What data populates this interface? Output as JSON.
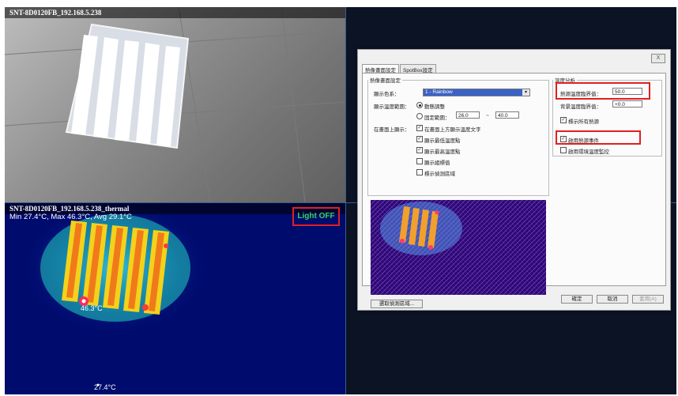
{
  "cameras": {
    "cam": {
      "title": "SNT-8D0120FB_192.168.5.238"
    },
    "thermal": {
      "title": "SNT-8D0120FB_192.168.5.238_thermal",
      "stats": "Min 27.4°C, Max 46.3°C, Avg 29.1°C",
      "status": "Light OFF",
      "max_marker": "46.3°C",
      "min_marker": "27.4°C"
    }
  },
  "dialog": {
    "close": "X",
    "tabs": [
      "熱像畫面設定",
      "SpotBox設定"
    ],
    "left_group": {
      "legend": "熱像畫面設定",
      "palette_label": "顯示色系：",
      "palette_value": "1 - Rainbow",
      "range_label": "顯示溫度範圍：",
      "auto_label": "動態調整",
      "fixed_label": "固定範圍：",
      "fixed_min": "26.0",
      "fixed_sep": "~",
      "fixed_max": "40.0",
      "overlay_label": "在畫面上顯示：",
      "overlay_options": [
        "在畫面上方顯示溫度文字",
        "顯示最低溫度點",
        "顯示最高溫度點",
        "顯示組標值",
        "標示偵測區域"
      ]
    },
    "right_group": {
      "legend": "溫度分析",
      "heat_label": "熱源溫度臨界值：",
      "heat_value": "50.0",
      "bg_label": "背景溫度臨界值：",
      "bg_value": "+0.0",
      "mark_all": "標示所有熱源",
      "enable_heat_event": "啟用熱源事件",
      "enable_env_monitor": "啟用環境溫度監控"
    },
    "select_area_button": "選取偵測區域...",
    "ok": "確定",
    "cancel": "取消",
    "apply": "套用(A)"
  }
}
